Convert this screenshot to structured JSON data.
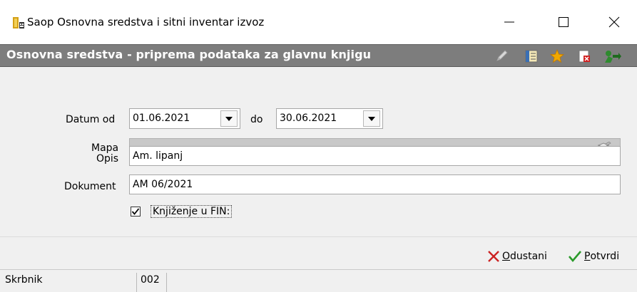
{
  "window": {
    "title": "Saop Osnovna sredstva i sitni inventar  izvoz",
    "minimize_icon": "minimize-icon",
    "maximize_icon": "maximize-icon",
    "close_icon": "close-icon"
  },
  "header": {
    "title": "Osnovna sredstva - priprema podataka za glavnu knjigu",
    "icons": [
      "edit-icon",
      "columns-icon",
      "star-icon",
      "delete-icon",
      "exit-icon"
    ]
  },
  "form": {
    "date_from_label": "Datum od",
    "date_from_value": "01.06.2021",
    "date_to_label": "do",
    "date_to_value": "30.06.2021",
    "folder_label": "Mapa",
    "folder_value": "",
    "description_label": "Opis",
    "description_value": "Am. lipanj",
    "document_label": "Dokument",
    "document_value": "AM 06/2021",
    "posting_label": "Knjiženje u FIN:",
    "posting_checked": true
  },
  "buttons": {
    "cancel_first": "O",
    "cancel_rest": "dustani",
    "confirm_first": "P",
    "confirm_rest": "otvrdi"
  },
  "statusbar": {
    "label": "Skrbnik",
    "value": "002"
  },
  "colors": {
    "header_band": "#7d7d7d",
    "form_background": "#f0f0f0",
    "disabled_field": "#c8c8c8",
    "cancel_icon": "#cc2222",
    "confirm_icon": "#2a9a2a",
    "star_icon": "#f0a800"
  }
}
